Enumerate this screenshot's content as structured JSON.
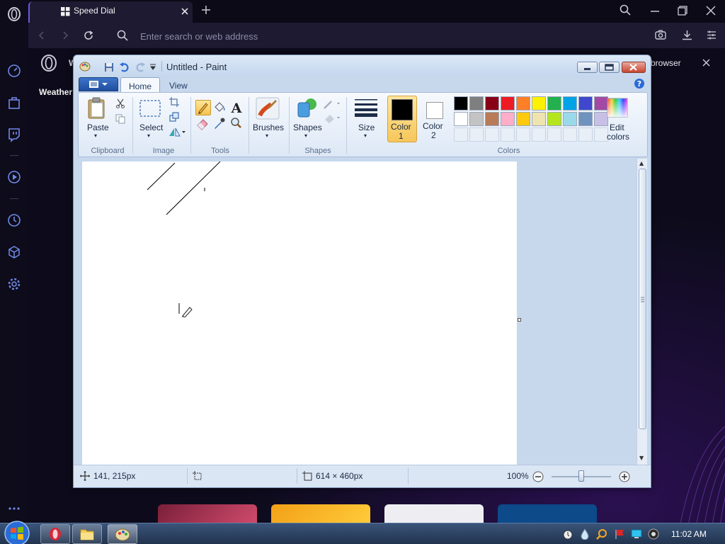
{
  "browser": {
    "tab_title": "Speed Dial",
    "address_placeholder": "Enter search or web address",
    "notice_text": "browser",
    "weather_label": "Weather"
  },
  "paint": {
    "window_title": "Untitled - Paint",
    "tabs": [
      "Home",
      "View"
    ],
    "ribbon": {
      "paste_label": "Paste",
      "select_label": "Select",
      "brushes_label": "Brushes",
      "shapes_label": "Shapes",
      "size_label": "Size",
      "color1_label": "Color",
      "color1_num": "1",
      "color2_label": "Color",
      "color2_num": "2",
      "edit_colors_label": "Edit",
      "edit_colors_label2": "colors",
      "groups": [
        "Clipboard",
        "Image",
        "Tools",
        "Shapes",
        "Colors"
      ]
    },
    "palette_row1": [
      "#000000",
      "#7f7f7f",
      "#880015",
      "#ed1c24",
      "#ff7f27",
      "#fff200",
      "#22b14c",
      "#00a2e8",
      "#3f48cc",
      "#a349a4"
    ],
    "palette_row2": [
      "#ffffff",
      "#c3c3c3",
      "#b97a57",
      "#ffaec9",
      "#ffc90e",
      "#efe4b0",
      "#b5e61d",
      "#99d9ea",
      "#7092be",
      "#c8bfe7"
    ],
    "color1": "#000000",
    "color2": "#ffffff",
    "status": {
      "cursor_pos": "141, 215px",
      "image_size": "614 × 460px",
      "zoom": "100%"
    }
  },
  "taskbar": {
    "clock": "11:02 AM"
  }
}
